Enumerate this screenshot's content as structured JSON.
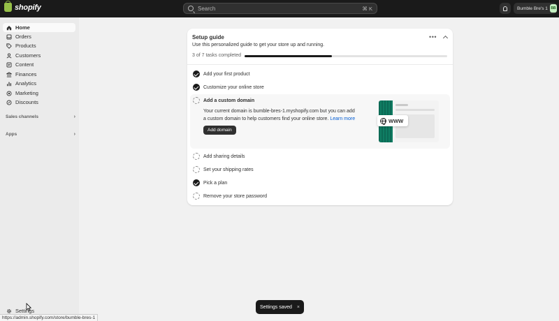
{
  "topbar": {
    "logo_text": "shopify",
    "search_placeholder": "Search",
    "search_shortcut": "⌘ K",
    "store_name": "Bumble Bre's 1",
    "store_initials": "BB"
  },
  "sidebar": {
    "items": [
      {
        "label": "Home",
        "icon": "home-icon"
      },
      {
        "label": "Orders",
        "icon": "orders-icon"
      },
      {
        "label": "Products",
        "icon": "tag-icon"
      },
      {
        "label": "Customers",
        "icon": "person-icon"
      },
      {
        "label": "Content",
        "icon": "content-icon"
      },
      {
        "label": "Finances",
        "icon": "bank-icon"
      },
      {
        "label": "Analytics",
        "icon": "chart-icon"
      },
      {
        "label": "Marketing",
        "icon": "target-icon"
      },
      {
        "label": "Discounts",
        "icon": "discount-icon"
      }
    ],
    "sales_channels": "Sales channels",
    "apps": "Apps",
    "settings": "Settings"
  },
  "status_url": "https://admin.shopify.com/store/bumble-bres-1",
  "setup_guide": {
    "title": "Setup guide",
    "description": "Use this personalized guide to get your store up and running.",
    "progress_label": "3 of 7 tasks completed",
    "progress_fraction": 0.43,
    "tasks": [
      {
        "label": "Add your first product",
        "done": true
      },
      {
        "label": "Customize your online store",
        "done": true
      },
      {
        "label": "Add a custom domain",
        "done": false
      },
      {
        "label": "Add sharing details",
        "done": false
      },
      {
        "label": "Set your shipping rates",
        "done": false
      },
      {
        "label": "Pick a plan",
        "done": true
      },
      {
        "label": "Remove your store password",
        "done": false
      }
    ],
    "expanded": {
      "body": "Your current domain is bumble-bres-1.myshopify.com but you can add a custom domain to help customers find your online store.",
      "link": "Learn more",
      "button": "Add domain",
      "badge": "WWW"
    }
  },
  "toast": {
    "message": "Settings saved",
    "close": "×"
  }
}
